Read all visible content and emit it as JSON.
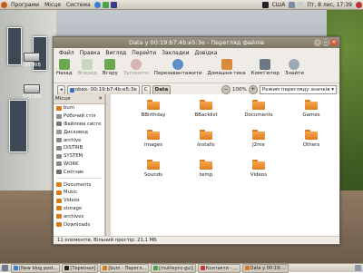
{
  "top_panel": {
    "menus": [
      "Програми",
      "Місця",
      "Система"
    ],
    "keyboard_layout": "США",
    "clock": "Пт, 8 лис, 17:39"
  },
  "desktop_icons": [
    "DISTRIB",
    "SYSTEM"
  ],
  "window": {
    "title": "Data у 00:19:b7:4b:e5:3e - Перегляд файлів",
    "menu": [
      "Файл",
      "Правка",
      "Вигляд",
      "Перейти",
      "Закладки",
      "Довідка"
    ],
    "toolbar": [
      {
        "label": "Назад",
        "icon": "back-arrow-icon",
        "enabled": true
      },
      {
        "label": "Вперед",
        "icon": "forward-arrow-icon",
        "enabled": false
      },
      {
        "label": "Вгору",
        "icon": "up-arrow-icon",
        "enabled": true
      },
      {
        "label": "Зупинити",
        "icon": "stop-icon",
        "enabled": false
      },
      {
        "label": "Перезавантажити",
        "icon": "reload-icon",
        "enabled": true
      },
      {
        "label": "Домашня тека",
        "icon": "home-icon",
        "enabled": true
      },
      {
        "label": "Комп'ютер",
        "icon": "computer-icon",
        "enabled": true
      },
      {
        "label": "Знайти",
        "icon": "search-icon",
        "enabled": true
      }
    ],
    "location": {
      "crumbs": [
        "obex: 00:19:b7:4b:e5:3e",
        "C",
        "Data"
      ],
      "zoom": "100%",
      "view_mode": "Режим перегляду значків"
    },
    "sidebar": {
      "header": "Місця",
      "items": [
        "bum",
        "Робочий стіл",
        "Файлова систе",
        "Дисковод",
        "archive",
        "DISTRIB",
        "SYSTEM",
        "WORK",
        "Смітник",
        "Documents",
        "Music",
        "Videos",
        "storage",
        "archives",
        "Downloads"
      ]
    },
    "files": [
      "BBirthday",
      "BBacklist",
      "Documents",
      "Games",
      "Images",
      "Installs",
      "J2me",
      "Others",
      "Sounds",
      "temp",
      "Videos"
    ],
    "status": "11 елементів, Вільний простір: 21,1 МБ"
  },
  "taskbar": [
    {
      "label": "[New blog post...",
      "active": false
    },
    {
      "label": "[Термінал]",
      "active": false
    },
    {
      "label": "[bum - Перегл...",
      "active": false
    },
    {
      "label": "[multisync-gui]",
      "active": false
    },
    {
      "label": "Контакти - ...",
      "active": false
    },
    {
      "label": "Data у 00:19:...",
      "active": true
    }
  ]
}
